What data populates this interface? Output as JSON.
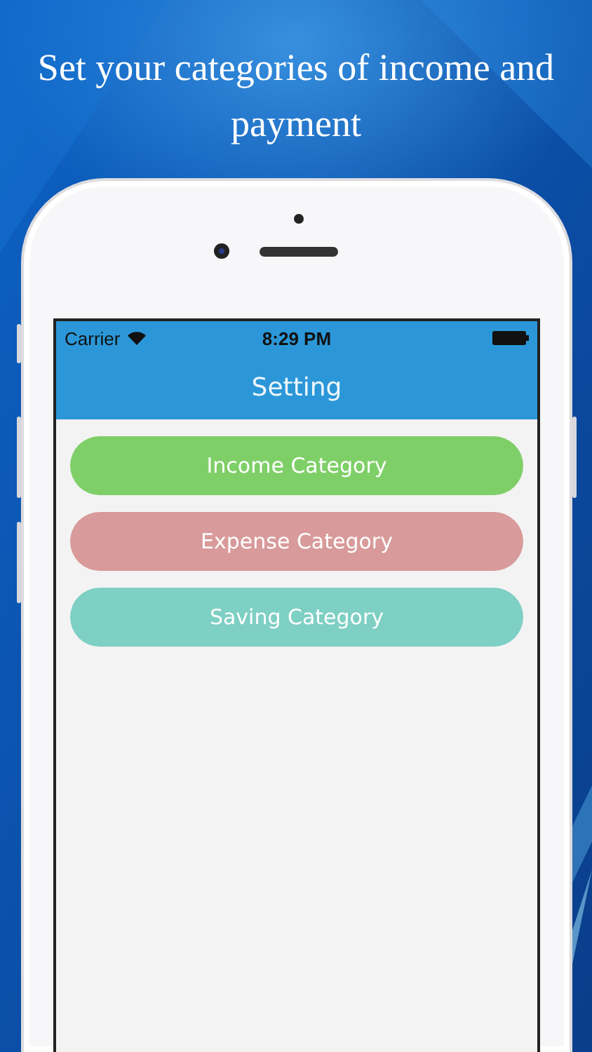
{
  "headline": "Set your categories of income and payment",
  "status_bar": {
    "carrier": "Carrier",
    "time": "8:29 PM"
  },
  "nav_bar": {
    "title": "Setting"
  },
  "category_buttons": [
    {
      "label": "Income Category",
      "color": "#7fcf68"
    },
    {
      "label": "Expense Category",
      "color": "#d89a9a"
    },
    {
      "label": "Saving Category",
      "color": "#7ecfc4"
    }
  ]
}
